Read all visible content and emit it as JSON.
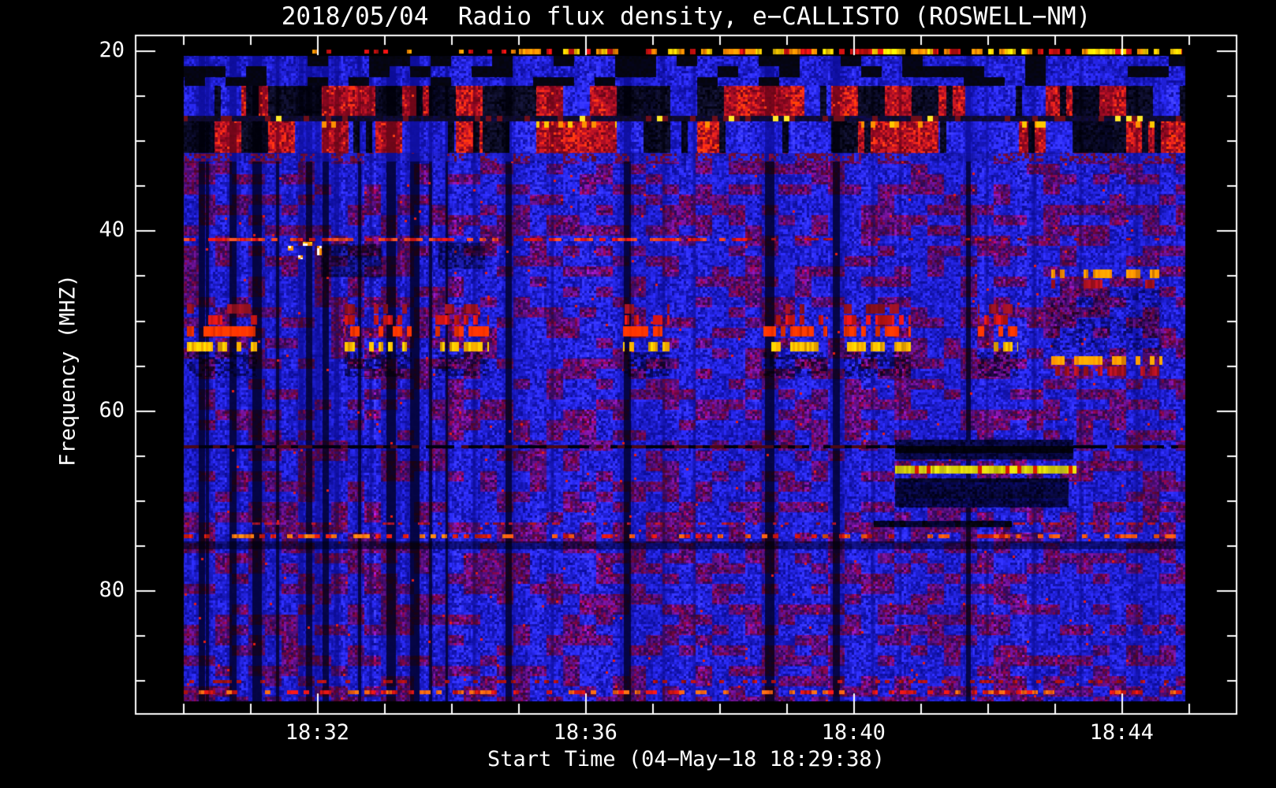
{
  "figure": {
    "background": "#000000",
    "foreground": "#ffffff"
  },
  "chart_data": {
    "type": "heatmap",
    "title": "2018/05/04  Radio flux density, e−CALLISTO (ROSWELL−NM)",
    "xlabel": "Start Time (04−May−18 18:29:38)",
    "ylabel": "Frequency (MHZ)",
    "legend": false,
    "grid": false,
    "axes": {
      "x_unit": "minutes after 18:28 UT",
      "x_frame_range_min": [
        1.29,
        17.715
      ],
      "y_frame_range_mhz": [
        18.34,
        93.65
      ],
      "x_major_ticks": [
        {
          "t": 4,
          "label": "18:32"
        },
        {
          "t": 8,
          "label": "18:36"
        },
        {
          "t": 12,
          "label": "18:40"
        },
        {
          "t": 16,
          "label": "18:44"
        }
      ],
      "x_minor_ticks": [
        2,
        3,
        5,
        6,
        7,
        9,
        10,
        11,
        13,
        14,
        15,
        17
      ],
      "y_major_ticks": [
        {
          "f": 20,
          "label": "20"
        },
        {
          "f": 40,
          "label": "40"
        },
        {
          "f": 60,
          "label": "60"
        },
        {
          "f": 80,
          "label": "80"
        }
      ],
      "y_minor_ticks": [
        25,
        30,
        35,
        45,
        50,
        55,
        65,
        70,
        75,
        85,
        90
      ]
    },
    "data_extent": {
      "t_min": [
        2.0,
        16.95
      ],
      "f_mhz": [
        19.0,
        92.0
      ]
    },
    "palette": {
      "background": "#000000",
      "axis": "#ffffff",
      "base_blue": "#2020e8",
      "purple": "#5018a8",
      "maroon": "#701430",
      "red": "#c81414",
      "bright_red": "#ff3300",
      "orange": "#ff8c00",
      "yellow": "#e8d800",
      "white": "#ffffff",
      "navy": "#000040",
      "yellow_line": "#d8d200",
      "yellow_line_tick": "#dc1800"
    },
    "features": {
      "top_band": {
        "f_end": 32.3,
        "black_top_f": 20.55,
        "blue_blob_f": [
          20.55,
          23.9
        ],
        "band1_f": [
          23.9,
          27.25
        ],
        "sep_f": [
          27.25,
          27.8
        ],
        "dash_sub_f": [
          27.8,
          28.55
        ],
        "band2_f": [
          28.55,
          31.35
        ],
        "trans_f": [
          31.35,
          32.3
        ]
      },
      "stripes": [
        {
          "t": 2.27,
          "w": 8,
          "d": 0.92
        },
        {
          "t": 2.36,
          "w": 4,
          "d": 0.8
        },
        {
          "t": 2.74,
          "w": 9,
          "d": 0.9
        },
        {
          "t": 3.1,
          "w": 12,
          "d": 0.93
        },
        {
          "t": 3.4,
          "w": 4,
          "d": 0.8
        },
        {
          "t": 3.75,
          "w": 6,
          "d": 0.75
        },
        {
          "t": 3.87,
          "w": 8,
          "d": 0.8
        },
        {
          "t": 4.0,
          "w": 6,
          "d": 0.7
        },
        {
          "t": 4.12,
          "w": 8,
          "d": 0.8
        },
        {
          "t": 4.28,
          "w": 6,
          "d": 0.75
        },
        {
          "t": 4.63,
          "w": 4,
          "d": 0.8
        },
        {
          "t": 4.8,
          "w": 3,
          "d": 0.7
        },
        {
          "t": 5.1,
          "w": 12,
          "d": 0.93
        },
        {
          "t": 5.45,
          "w": 12,
          "d": 0.93
        },
        {
          "t": 5.69,
          "w": 4,
          "d": 0.8
        },
        {
          "t": 5.93,
          "w": 3,
          "d": 0.85
        },
        {
          "t": 6.34,
          "w": 3,
          "d": 0.7
        },
        {
          "t": 6.85,
          "w": 8,
          "d": 0.85
        },
        {
          "t": 7.5,
          "w": 3,
          "d": 0.7
        },
        {
          "t": 8.62,
          "w": 9,
          "d": 0.9
        },
        {
          "t": 9.16,
          "w": 3,
          "d": 0.65
        },
        {
          "t": 9.62,
          "w": 3,
          "d": 0.65
        },
        {
          "t": 10.74,
          "w": 12,
          "d": 0.88
        },
        {
          "t": 11.74,
          "w": 9,
          "d": 0.85
        },
        {
          "t": 12.28,
          "w": 3,
          "d": 0.6
        },
        {
          "t": 12.69,
          "w": 3,
          "d": 0.6
        },
        {
          "t": 13.71,
          "w": 6,
          "d": 0.8
        },
        {
          "t": 13.98,
          "w": 3,
          "d": 0.6
        },
        {
          "t": 14.69,
          "w": 4,
          "d": 0.7
        },
        {
          "t": 15.39,
          "w": 3,
          "d": 0.6
        },
        {
          "t": 16.22,
          "w": 3,
          "d": 0.65
        },
        {
          "t": 16.56,
          "w": 2,
          "d": 0.5
        }
      ],
      "h_dash_rows": [
        {
          "f": 20.1,
          "h": 7,
          "t0": 7.0,
          "t1": 16.9,
          "density": 0.62,
          "dash": 7,
          "colors": [
            "#ff8c00",
            "#ffd000",
            "#d01010"
          ]
        },
        {
          "f": 20.1,
          "h": 5,
          "t0": 3.6,
          "t1": 7.0,
          "density": 0.18,
          "dash": 6,
          "colors": [
            "#ff8c00",
            "#d01010"
          ]
        },
        {
          "f": 40.95,
          "h": 4,
          "t0": 2.0,
          "t1": 10.4,
          "density": 0.65,
          "dash": 8,
          "colors": [
            "#d81414",
            "#ff4820"
          ]
        },
        {
          "f": 40.95,
          "h": 3,
          "t0": 10.4,
          "t1": 16.9,
          "density": 0.22,
          "dash": 6,
          "colors": [
            "#b01010"
          ]
        },
        {
          "f": 72.55,
          "h": 3,
          "t0": 2.0,
          "t1": 16.9,
          "density": 0.3,
          "dash": 5,
          "colors": [
            "#a81428"
          ],
          "exclude": [
            12.3,
            14.35
          ]
        },
        {
          "f": 73.95,
          "h": 5,
          "t0": 2.0,
          "t1": 6.8,
          "density": 0.55,
          "dash": 7,
          "colors": [
            "#dc1c10",
            "#ff7810"
          ]
        },
        {
          "f": 73.95,
          "h": 5,
          "t0": 6.8,
          "t1": 16.9,
          "density": 0.32,
          "dash": 7,
          "colors": [
            "#c41410",
            "#ff5810"
          ]
        },
        {
          "f": 90.1,
          "h": 4,
          "t0": 2.0,
          "t1": 16.9,
          "density": 0.25,
          "dash": 6,
          "colors": [
            "#a81010"
          ]
        },
        {
          "f": 91.3,
          "h": 5,
          "t0": 2.0,
          "t1": 16.9,
          "density": 0.5,
          "dash": 7,
          "colors": [
            "#d41414",
            "#ff6410"
          ]
        }
      ],
      "black_dash_line": {
        "f": 64.05,
        "h": 4,
        "dash": 9,
        "t0": 2.0,
        "t1": 16.95,
        "colors": [
          "#000010",
          "#480818"
        ]
      },
      "cluster": {
        "rows": [
          {
            "f": 48.7,
            "color": "#8c1020",
            "density": 0.45
          },
          {
            "f": 49.9,
            "color": "#c81414",
            "density": 0.55
          },
          {
            "f": 51.2,
            "color": "#ff3300",
            "density": 0.6
          },
          {
            "f": 52.9,
            "color": "#ffb400",
            "density": 0.55
          }
        ],
        "navy_band": {
          "f0": 53.5,
          "f1": 56.2,
          "density": 0.45
        },
        "spans": [
          [
            2.05,
            3.1
          ],
          [
            4.4,
            5.4
          ],
          [
            5.75,
            6.55
          ],
          [
            8.55,
            9.25
          ],
          [
            10.65,
            11.6
          ],
          [
            11.85,
            12.85
          ],
          [
            13.85,
            14.45
          ]
        ]
      },
      "right_cluster": {
        "rows": [
          {
            "f": 44.8,
            "color": "#ff9000",
            "density": 0.6
          },
          {
            "f": 45.9,
            "color": "#a81020",
            "density": 0.5
          },
          {
            "f": 54.4,
            "color": "#ff9000",
            "density": 0.6
          },
          {
            "f": 55.6,
            "color": "#a81020",
            "density": 0.5
          }
        ],
        "span": [
          14.95,
          16.6
        ],
        "navy_band": {
          "f0": 46.6,
          "f1": 53.6,
          "density": 0.3
        }
      },
      "bright_spots": {
        "f0": 41.2,
        "f1": 43.2,
        "t0": 3.55,
        "t1": 4.15,
        "colors": [
          "#ffffff",
          "#ffd800",
          "#ff9000"
        ]
      },
      "dark_patches": [
        {
          "f0": 41.5,
          "f1": 45.2,
          "t0": 4.05,
          "t1": 4.95
        },
        {
          "f0": 41.3,
          "f1": 44.2,
          "t0": 5.8,
          "t1": 6.5
        }
      ],
      "blocks": {
        "navy1": {
          "f0": 63.2,
          "f1": 65.45,
          "t0": 12.62,
          "t1": 15.27,
          "core_f0": 63.95,
          "core_f1": 64.75
        },
        "yellow_line": {
          "f0": 66.15,
          "f1": 66.95,
          "t0": 12.62,
          "t1": 15.32,
          "tick_density": 0.13
        },
        "navy2": {
          "f0": 67.5,
          "f1": 70.75,
          "t0": 12.62,
          "t1": 15.2
        },
        "dark_line_72": {
          "f0": 72.2,
          "f1": 72.95,
          "t0": 12.3,
          "t1": 14.35
        }
      },
      "navy_row": {
        "f0": 74.55,
        "f1": 75.35
      }
    }
  }
}
